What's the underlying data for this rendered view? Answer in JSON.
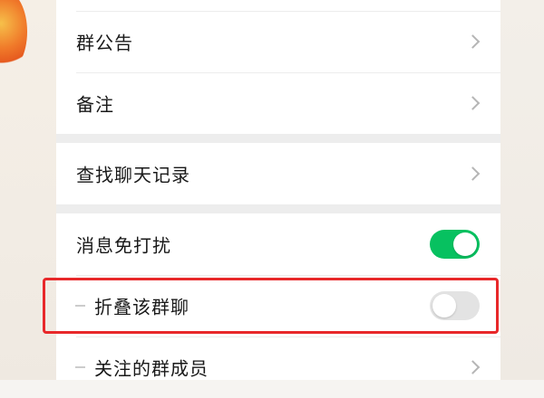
{
  "settings": {
    "group_notice": {
      "label": "群公告"
    },
    "remark": {
      "label": "备注"
    },
    "search_history": {
      "label": "查找聊天记录"
    },
    "mute": {
      "label": "消息免打扰",
      "enabled": true
    },
    "fold_chat": {
      "label": "折叠该群聊",
      "enabled": false
    },
    "followed_members": {
      "label": "关注的群成员"
    }
  },
  "colors": {
    "toggle_on": "#07c160",
    "toggle_off": "#e3e3e3",
    "highlight_box": "#e8282a",
    "page_bg": "#ededed"
  },
  "icons": {
    "row_arrow": "chevron-right-icon"
  }
}
